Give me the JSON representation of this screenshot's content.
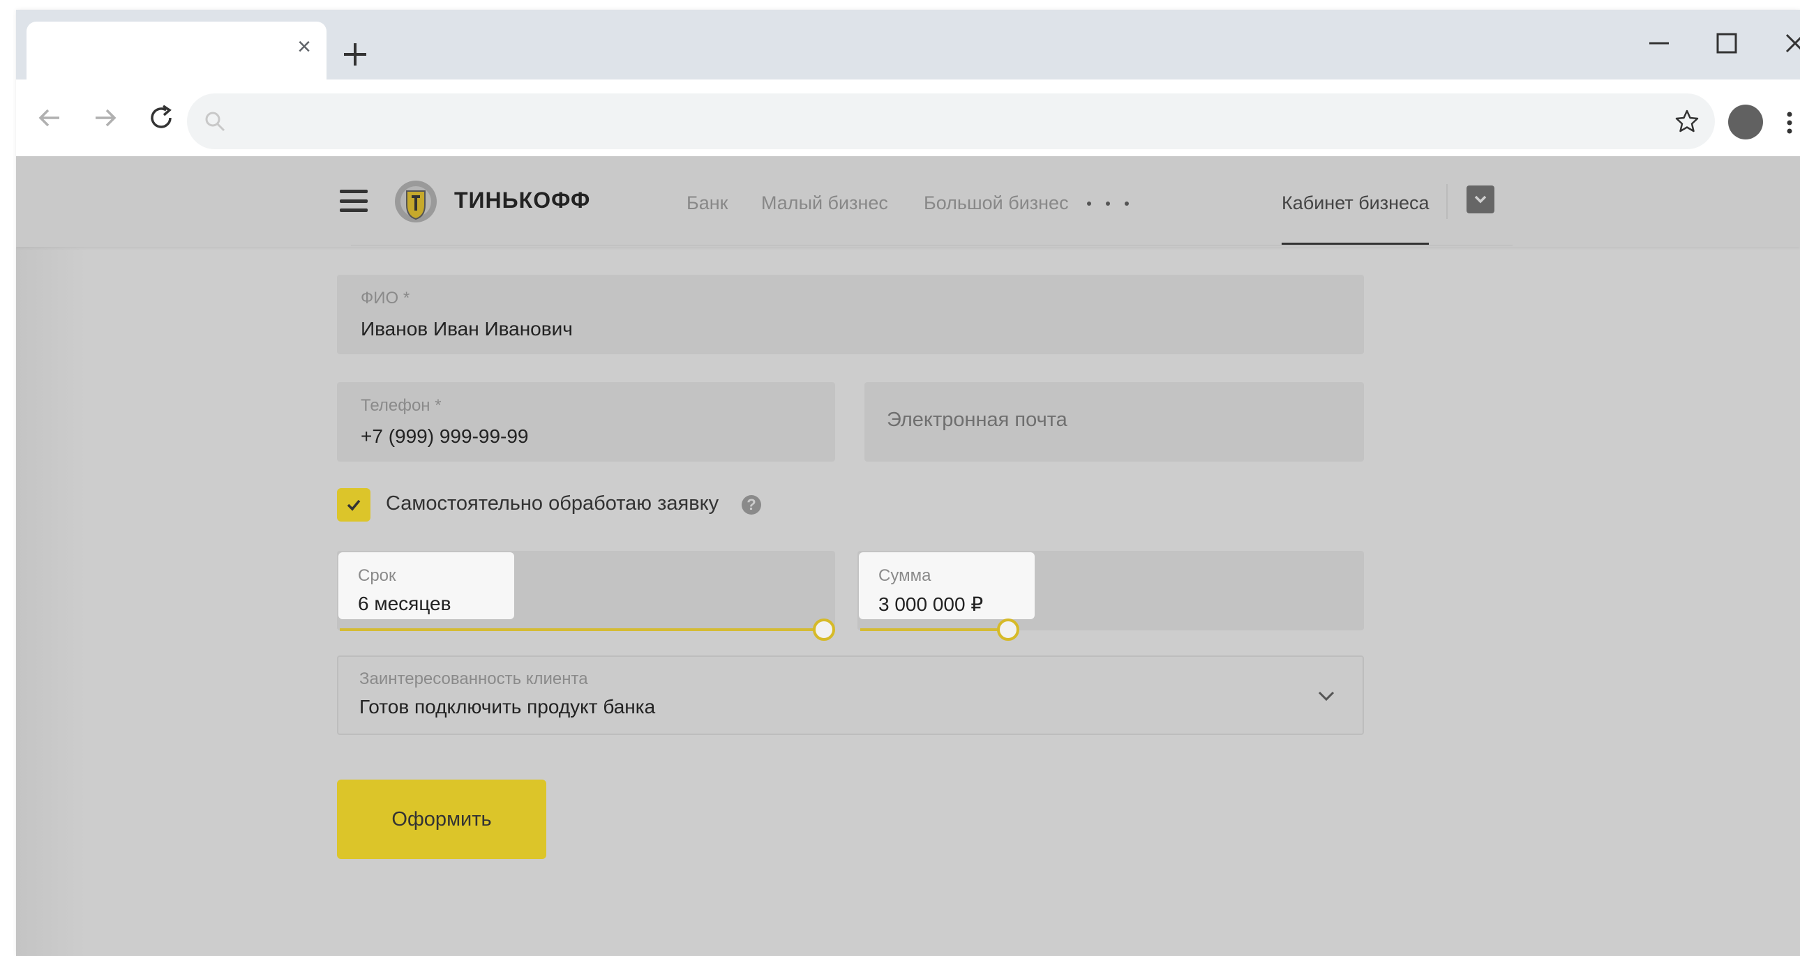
{
  "browser": {
    "tab_title": "",
    "tab_close_glyph": "×",
    "omnibox_value": "",
    "icons": {
      "back": "arrow-left-icon",
      "forward": "arrow-right-icon",
      "reload": "reload-icon",
      "search": "search-icon",
      "star": "star-icon",
      "new_tab": "plus-icon",
      "minimize": "minimize-icon",
      "maximize": "maximize-icon",
      "close": "close-icon"
    }
  },
  "site": {
    "logo_text": "ТИНЬКОФФ",
    "nav": [
      "Банк",
      "Малый бизнес",
      "Большой бизнес"
    ],
    "cabinet_label": "Кабинет бизнеса"
  },
  "form": {
    "fio": {
      "label": "ФИО *",
      "value": "Иванов Иван Иванович"
    },
    "phone": {
      "label": "Телефон *",
      "value": "+7 (999) 999-99-99"
    },
    "email": {
      "placeholder": "Электронная почта"
    },
    "self_process": {
      "label": "Самостоятельно обработаю заявку",
      "checked": true
    },
    "term": {
      "label": "Срок",
      "value": "6 месяцев",
      "slider_fraction": 1.0
    },
    "amount": {
      "label": "Сумма",
      "value": "3 000 000 ₽",
      "slider_fraction": 0.3
    },
    "interest": {
      "label": "Заинтересованность клиента",
      "value": "Готов подключить продукт банка"
    },
    "submit_label": "Оформить"
  },
  "colors": {
    "accent_yellow": "#dcc52a",
    "page_bg": "#cdcdcd"
  }
}
